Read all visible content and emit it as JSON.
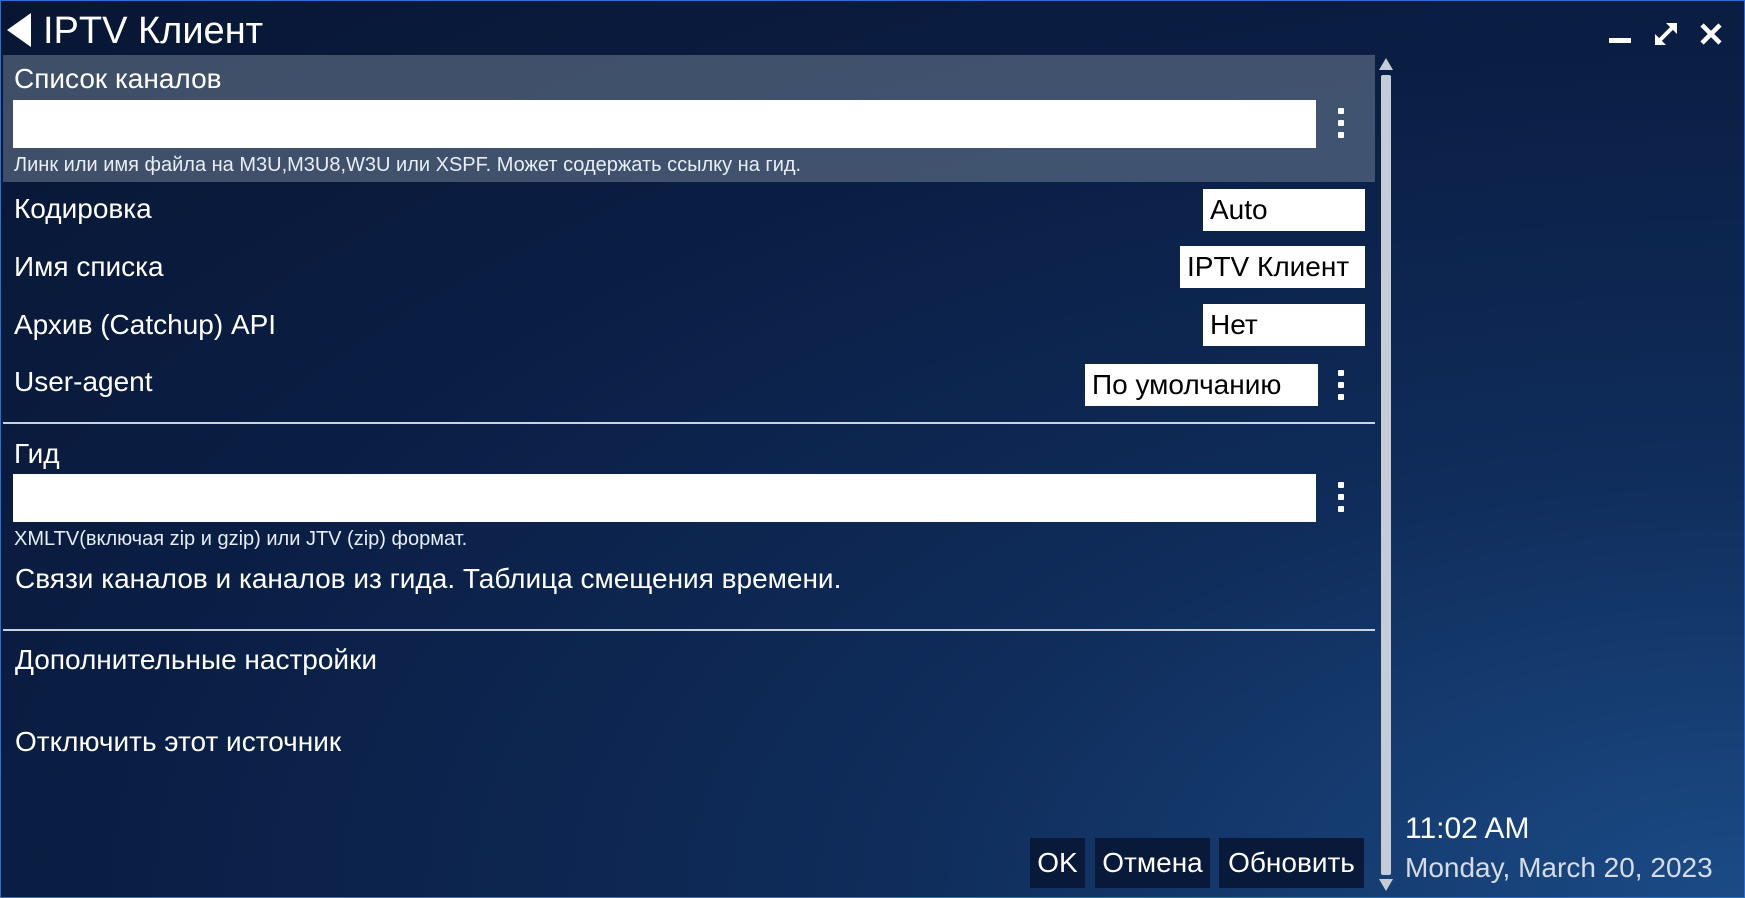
{
  "window": {
    "title": "IPTV Клиент",
    "back_icon": "back-arrow-icon",
    "minimize_icon": "minimize-icon",
    "maximize_icon": "maximize-icon",
    "close_icon": "close-icon"
  },
  "channel_list": {
    "label": "Список каналов",
    "value": "",
    "hint": "Линк или имя файла на M3U,M3U8,W3U или XSPF. Может содержать ссылку на гид."
  },
  "encoding": {
    "label": "Кодировка",
    "value": "Auto"
  },
  "list_name": {
    "label": "Имя списка",
    "value": "IPTV Клиент"
  },
  "catchup": {
    "label": "Архив (Catchup) API",
    "value": "Нет"
  },
  "user_agent": {
    "label": "User-agent",
    "value": "По умолчанию"
  },
  "guide": {
    "label": "Гид",
    "value": "",
    "hint": "XMLTV(включая zip и gzip) или JTV (zip) формат."
  },
  "links": {
    "label": "Связи каналов и каналов из гида. Таблица смещения времени."
  },
  "advanced": {
    "label": "Дополнительные настройки"
  },
  "disable": {
    "label": "Отключить этот источник"
  },
  "buttons": {
    "ok": "OK",
    "cancel": "Отмена",
    "refresh": "Обновить"
  },
  "clock": {
    "time": "11:02 AM",
    "date": "Monday, March 20, 2023"
  },
  "colors": {
    "background": "#0a1d42",
    "highlight": "#5f6e82",
    "border": "#2a6fd8"
  }
}
